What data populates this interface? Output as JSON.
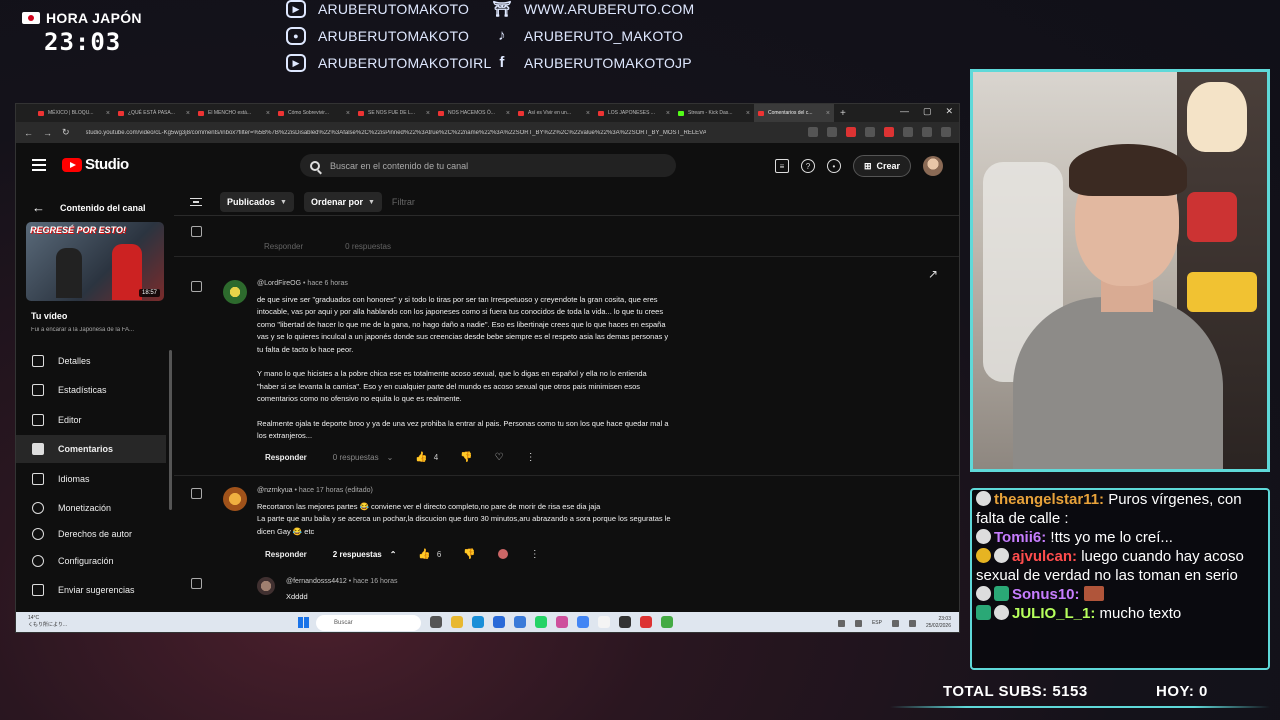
{
  "overlay": {
    "japan_label": "HORA JAPÓN",
    "japan_time": "23:03",
    "socials": [
      {
        "icon": "twitch-icon",
        "glyph": "▭",
        "text": "ARUBERUTOMAKOTO"
      },
      {
        "icon": "instagram-icon",
        "glyph": "◎",
        "text": "ARUBERUTOMAKOTO"
      },
      {
        "icon": "twitch-icon",
        "glyph": "▭",
        "text": "ARUBERUTOMAKOTOIRL"
      },
      {
        "icon": "torii-icon",
        "glyph": "⛩",
        "text": "WWW.ARUBERUTO.COM"
      },
      {
        "icon": "tiktok-icon",
        "glyph": "♪",
        "text": "ARUBERUTO_MAKOTO"
      },
      {
        "icon": "facebook-icon",
        "glyph": "f",
        "text": "ARUBERUTOMAKOTOJP"
      }
    ],
    "total_subs": "TOTAL SUBS: 5153",
    "today": "HOY: 0",
    "accent_color": "#5fd9d9"
  },
  "chat": [
    {
      "user": "theangelstar11:",
      "color": "#e8a23a",
      "text": " Puros vírgenes, con falta de calle :"
    },
    {
      "user": "Tomii6:",
      "color": "#c77dff",
      "text": " !tts yo me lo creí..."
    },
    {
      "user": "ajvulcan:",
      "color": "#ff4d4d",
      "text": " luego cuando hay acoso sexual de verdad no las toman en serio"
    },
    {
      "user": "Sonus10:",
      "color": "#c77dff",
      "text": " "
    },
    {
      "user": "JULIO_L_1:",
      "color": "#b6ff5c",
      "text": " mucho texto"
    }
  ],
  "browser": {
    "tabs": [
      "MÉXICO | BLOQU...",
      "¿QUÉ ESTÁ PASA...",
      "El MENCHO está...",
      "Cómo Sobrevivir...",
      "SE NOS FUE DE L...",
      "NOS HACEMOS Ó...",
      "Así es Vivir en un...",
      "LOS JAPONESES ...",
      "Stream - Kick Das...",
      "Comentarios del c..."
    ],
    "url": "studio.youtube.com/video/cL-Kg5wg3j8/comments/inbox?filter=%5B%7B%22isDisabled%22%3Afalse%2C%22isPinned%22%3Atrue%2C%22name%22%3A%22SORT_BY%22%2C%22value%22%3A%22SORT_BY_MOST_RELEVANT%22%7D%5D"
  },
  "studio": {
    "logo_text": "Studio",
    "search_placeholder": "Buscar en el contenido de tu canal",
    "create_label": "Crear",
    "channel_content": "Contenido del canal",
    "thumb_overlay": "REGRESÉ POR ESTO!",
    "thumb_duration": "18:57",
    "your_video": "Tu vídeo",
    "video_title": "Fui a encarar a la Japonesa de la FA...",
    "nav": [
      {
        "label": "Detalles",
        "name": "detalles",
        "active": false
      },
      {
        "label": "Estadísticas",
        "name": "estadisticas",
        "active": false
      },
      {
        "label": "Editor",
        "name": "editor",
        "active": false
      },
      {
        "label": "Comentarios",
        "name": "comentarios",
        "active": true
      },
      {
        "label": "Idiomas",
        "name": "idiomas",
        "active": false
      },
      {
        "label": "Monetización",
        "name": "monetizacion",
        "active": false
      },
      {
        "label": "Derechos de autor",
        "name": "derechos-de-autor",
        "active": false
      }
    ],
    "settings": "Configuración",
    "feedback": "Enviar sugerencias",
    "filters": {
      "published": "Publicados",
      "order": "Ordenar por",
      "filter_placeholder": "Filtrar"
    },
    "ghost_row": {
      "reply": "Responder",
      "replies": "0 respuestas"
    },
    "comments": [
      {
        "handle": "@LordFireOG",
        "time": "hace 6 horas",
        "paragraphs": [
          "de que sirve ser \"graduados con honores\" y si todo lo tiras por ser tan Irrespetuoso y creyendote la gran cosita, que eres intocable, vas por aqui y por alla hablando con los japoneses como si fuera tus conocidos de toda la vida... lo que tu crees como \"libertad de hacer lo que me de la gana, no hago daño a nadie\". Eso es libertinaje crees que lo que haces en españa vas y se lo quieres inculcal a un japonés donde sus creencias desde bebe siempre es el respeto asia las demas personas y tu falta de tacto lo hace peor.",
          "Y mano lo que hicistes a la pobre chica ese es totalmente acoso sexual, que lo digas en español y ella no lo entienda \"haber si se levanta la camisa\". Eso y en cualquier parte del mundo es acoso sexual que otros pais minimisen esos comentarios como no ofensivo no equita lo que es realmente.",
          "Realmente ojala te deporte broo y ya de una vez prohiba la entrar al pais. Personas como tu son los que hace quedar mal a los extranjeros..."
        ],
        "reply": "Responder",
        "replies": "0 respuestas",
        "likes": "4"
      },
      {
        "handle": "@nzrnkyua",
        "time": "hace 17 horas (editado)",
        "paragraphs": [
          "Recortaron las mejores partes 😂 conviene ver el directo completo,no pare de morir de risa ese dia jaja",
          "La parte que aru baila y se acerca un pochar,la discucion que duro 30 minutos,aru abrazando a sora porque los seguratas le dicen Gay 😂 etc"
        ],
        "reply": "Responder",
        "replies": "2 respuestas",
        "likes": "6"
      },
      {
        "handle": "@fernandosss4412",
        "time": "hace 16 horas",
        "paragraphs": [
          "Xdddd"
        ]
      }
    ]
  },
  "taskbar": {
    "weather_temp": "14°C",
    "weather_desc": "くもり所により...",
    "search": "Buscar",
    "lang": "ESP",
    "clock_time": "23:03",
    "clock_date": "25/02/2026"
  }
}
